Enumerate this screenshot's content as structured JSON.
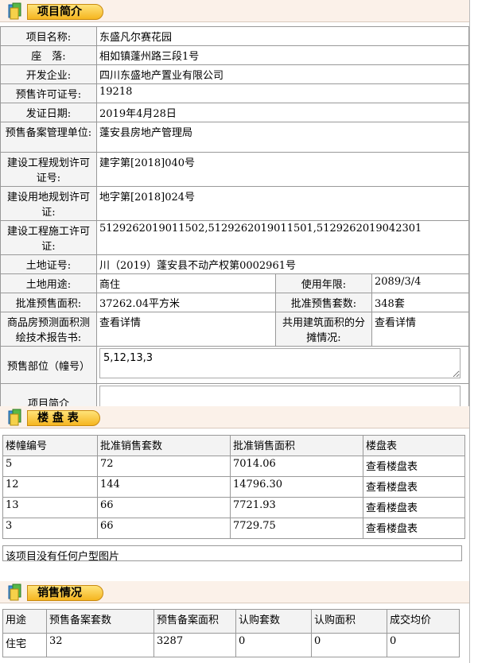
{
  "sections": {
    "intro_title": "项目简介",
    "building_title": "楼 盘 表",
    "sales_title": "销售情况"
  },
  "info": {
    "name_label": "项目名称:",
    "name": "东盛凡尔赛花园",
    "location_label": "座　落:",
    "location": "相如镇蓬州路三段1号",
    "developer_label": "开发企业:",
    "developer": "四川东盛地产置业有限公司",
    "permit_label": "预售许可证号:",
    "permit": "19218",
    "issue_label": "发证日期:",
    "issue_date": "2019年4月28日",
    "agency_label": "预售备案管理单位:",
    "agency": "蓬安县房地产管理局",
    "plan_label": "建设工程规划许可证号:",
    "plan": "建字第[2018]040号",
    "land_use_permit_label": "建设用地规划许可证:",
    "land_use_permit": "地字第[2018]024号",
    "construction_label": "建设工程施工许可证:",
    "construction": "5129262019011502,5129262019011501,5129262019042301",
    "land_cert_label": "土地证号:",
    "land_cert": "川（2019）蓬安县不动产权第0002961号",
    "land_purpose_label": "土地用途:",
    "land_purpose": "商住",
    "years_label": "使用年限:",
    "years": "2089/3/4",
    "area_label": "批准预售面积:",
    "area": "37262.04平方米",
    "units_label": "批准预售套数:",
    "units": "348套",
    "report_label": "商品房预测面积测绘技术报告书:",
    "report": "查看详情",
    "shared_label": "共用建筑面积的分摊情况:",
    "shared": "查看详情",
    "presale_part_label": "预售部位（幢号）",
    "presale_part": "5,12,13,3",
    "project_intro_label": "项目简介",
    "project_intro": ""
  },
  "building_table": {
    "headers": [
      "楼幢编号",
      "批准销售套数",
      "批准销售面积",
      "楼盘表"
    ],
    "rows": [
      [
        "5",
        "72",
        "7014.06",
        "查看楼盘表"
      ],
      [
        "12",
        "144",
        "14796.30",
        "查看楼盘表"
      ],
      [
        "13",
        "66",
        "7721.93",
        "查看楼盘表"
      ],
      [
        "3",
        "66",
        "7729.75",
        "查看楼盘表"
      ]
    ],
    "no_picture": "该项目没有任何户型图片"
  },
  "sales_table": {
    "headers": [
      "用途",
      "预售备案套数",
      "预售备案面积",
      "认购套数",
      "认购面积",
      "成交均价"
    ],
    "rows": [
      [
        "住宅",
        "32",
        "3287",
        "0",
        "0",
        "0"
      ]
    ]
  },
  "colors": {
    "tab": "#f5b51f",
    "bar": "#fbf1e9"
  }
}
